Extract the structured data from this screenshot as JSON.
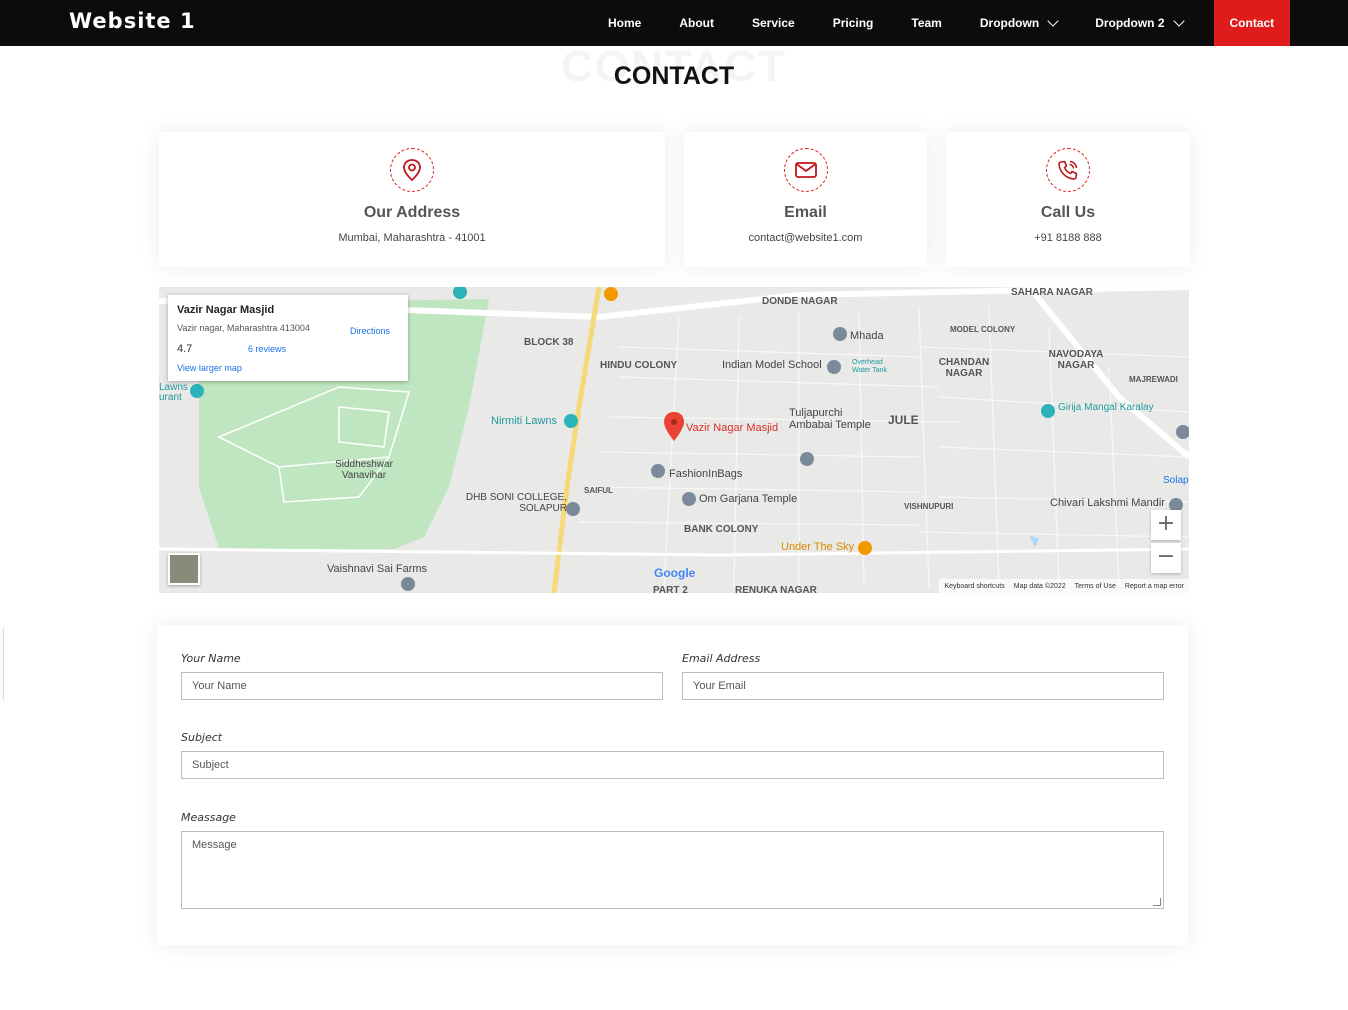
{
  "header": {
    "logo": "Website 1",
    "nav": [
      {
        "label": "Home"
      },
      {
        "label": "About"
      },
      {
        "label": "Service"
      },
      {
        "label": "Pricing"
      },
      {
        "label": "Team"
      },
      {
        "label": "Dropdown"
      },
      {
        "label": "Dropdown 2"
      },
      {
        "label": "Contact"
      }
    ],
    "accent": "#e01b1b"
  },
  "section": {
    "title": "CONTACT",
    "watermark": "CONTACT"
  },
  "info": [
    {
      "icon": "map-pin-icon",
      "title": "Our Address",
      "text": "Mumbai, Maharashtra - 41001"
    },
    {
      "icon": "envelope-icon",
      "title": "Email",
      "text": "contact@website1.com"
    },
    {
      "icon": "phone-icon",
      "title": "Call Us",
      "text": "+91 8188 888"
    }
  ],
  "map": {
    "card": {
      "title": "Vazir Nagar Masjid",
      "address": "Vazir nagar, Maharashtra 413004",
      "directions": "Directions",
      "rating": "4.7",
      "reviews": "6 reviews",
      "larger": "View larger map"
    },
    "pin_label": "Vazir Nagar Masjid",
    "areas": [
      "DONDE NAGAR",
      "BLOCK 38",
      "HINDU COLONY",
      "CHANDAN NAGAR",
      "NAVODAYA NAGAR",
      "SAHARA NAGAR",
      "JULE",
      "BANK COLONY",
      "VISHNUPURI",
      "MODEL COLONY",
      "MAJREWADI",
      "SAIFUL",
      "RENUKA NAGAR",
      "PART 2"
    ],
    "pois": [
      "Mhada",
      "Indian Model School",
      "Nirmiti Lawns",
      "Tuljapurchi Ambabai Temple",
      "FashionInBags",
      "Om Garjana Temple",
      "Siddheshwar Vanavihar",
      "DHB SONI COLLEGE, SOLAPUR",
      "Under The Sky",
      "Vaishnavi Sai Farms",
      "Girija Mangal Karalay",
      "Chivari Lakshmi Mandir",
      "Overhead Water Tank",
      "Lawns urant",
      "Solap"
    ],
    "zoom_in": "+",
    "zoom_out": "−",
    "google": "Google",
    "footer": [
      "Keyboard shortcuts",
      "Map data ©2022",
      "Terms of Use",
      "Report a map error"
    ]
  },
  "form": {
    "name_label": "Your Name",
    "name_placeholder": "Your Name",
    "email_label": "Email Address",
    "email_placeholder": "Your Email",
    "subject_label": "Subject",
    "subject_placeholder": "Subject",
    "message_label": "Meassage",
    "message_placeholder": "Message"
  }
}
